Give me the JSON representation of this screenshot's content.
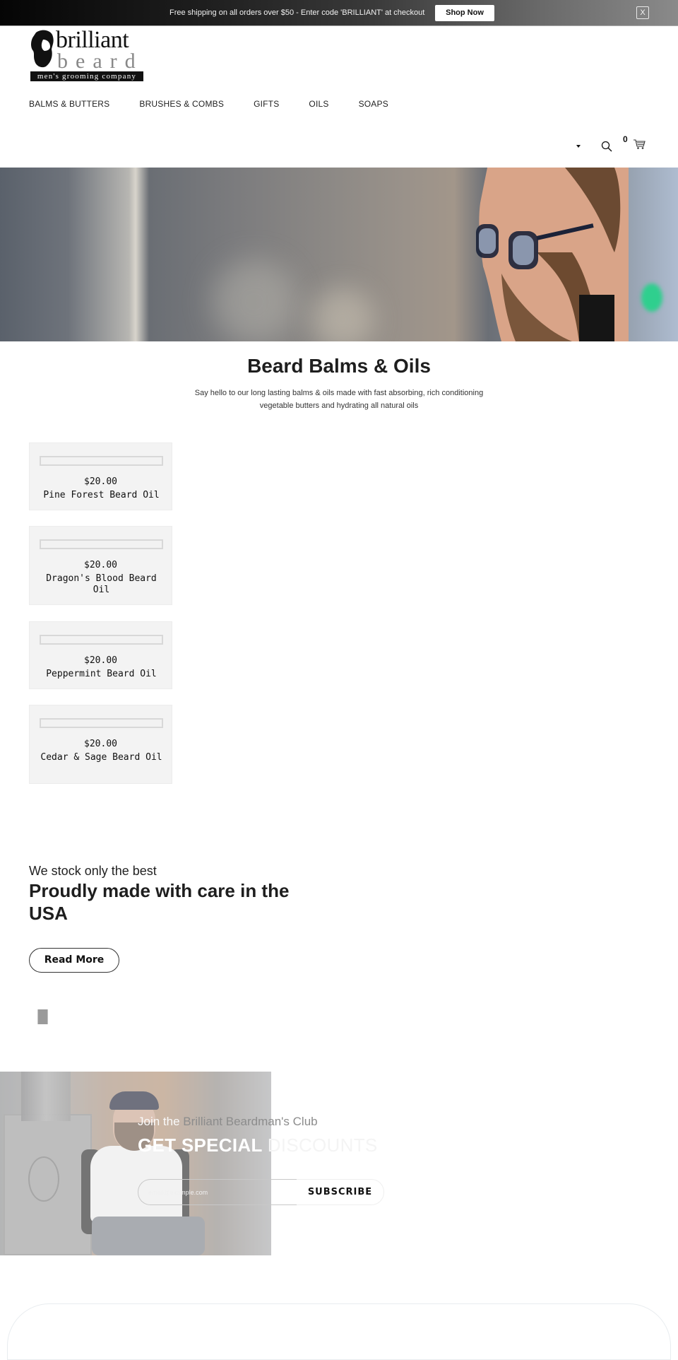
{
  "announcement": {
    "text": "Free shipping on all orders over $50 - Enter code 'BRILLIANT' at checkout",
    "button_label": "Shop Now",
    "close_label": "X"
  },
  "logo": {
    "word1": "brilliant",
    "word2": "beard",
    "tagline": "men's grooming company"
  },
  "nav": {
    "items": [
      {
        "label": "BALMS & BUTTERS"
      },
      {
        "label": "BRUSHES & COMBS"
      },
      {
        "label": "GIFTS"
      },
      {
        "label": "OILS"
      },
      {
        "label": "SOAPS"
      }
    ]
  },
  "header_icons": {
    "dropdown": "caret-down-icon",
    "search": "search-icon",
    "cart": "cart-icon",
    "cart_count": "0"
  },
  "collection": {
    "title": "Beard Balms & Oils",
    "description": "Say hello to our long lasting balms & oils made with fast absorbing, rich conditioning vegetable butters and hydrating all natural oils"
  },
  "products": [
    {
      "price": "$20.00",
      "name": "Pine Forest Beard Oil"
    },
    {
      "price": "$20.00",
      "name": "Dragon's Blood Beard Oil"
    },
    {
      "price": "$20.00",
      "name": "Peppermint Beard Oil"
    },
    {
      "price": "$20.00",
      "name": "Cedar & Sage Beard Oil"
    }
  ],
  "promo": {
    "kicker": "We stock only the best",
    "title": "Proudly made with care in the USA",
    "button_label": "Read More"
  },
  "newsletter": {
    "join_prefix": "Join the",
    "join_brand": "Brilliant Beardman's Club",
    "headline_main": "GET SPECIAL",
    "headline_faint": "DISCOUNTS",
    "email_placeholder": "email@example.com",
    "subscribe_label": "SUBSCRIBE"
  },
  "colors": {
    "announcement_start": "#050505",
    "announcement_end": "#8a8a8a",
    "card_bg": "#f3f3f3",
    "text_dark": "#1e1e1e",
    "brand_gray": "#8c8c8c"
  }
}
